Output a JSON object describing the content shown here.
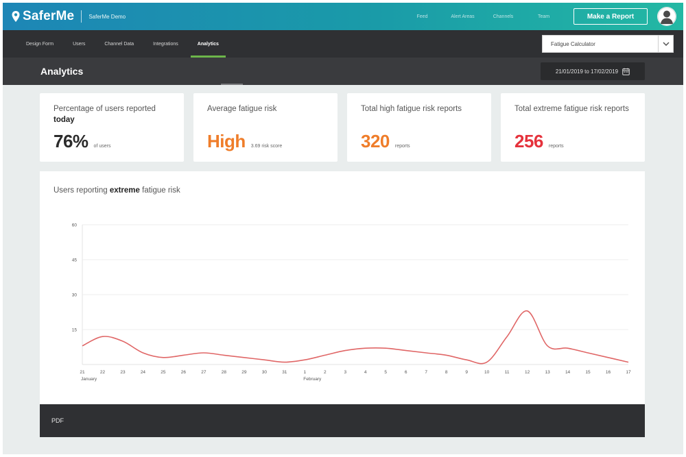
{
  "header": {
    "brand": "SaferMe",
    "org": "SaferMe Demo",
    "links": [
      "Feed",
      "Alert Areas",
      "Channels",
      "Team"
    ],
    "report_button": "Make a Report"
  },
  "subnav": {
    "tabs": [
      "Design Form",
      "Users",
      "Channel Data",
      "Integrations",
      "Analytics"
    ],
    "active_tab": "Analytics",
    "calculator_select": "Fatigue Calculator"
  },
  "titlebar": {
    "title": "Analytics",
    "date_range": "21/01/2019 to 17/02/2019"
  },
  "cards": [
    {
      "label_pre": "Percentage of users reported ",
      "label_bold": "today",
      "label_post": "",
      "value": "76%",
      "unit": "of users",
      "color": "#2b2b2b"
    },
    {
      "label_pre": "Average fatigue risk",
      "label_bold": "",
      "label_post": "",
      "value": "High",
      "unit": "3.69 risk score",
      "color": "#ef7d2a"
    },
    {
      "label_pre": "Total high fatigue risk reports",
      "label_bold": "",
      "label_post": "",
      "value": "320",
      "unit": "reports",
      "color": "#ef7d2a"
    },
    {
      "label_pre": "Total extreme fatigue risk reports",
      "label_bold": "",
      "label_post": "",
      "value": "256",
      "unit": "reports",
      "color": "#e5323c"
    }
  ],
  "chart": {
    "title_pre": "Users reporting ",
    "title_bold": "extreme",
    "title_post": " fatigue risk"
  },
  "chart_data": {
    "type": "line",
    "title": "Users reporting extreme fatigue risk",
    "x": [
      "21",
      "22",
      "23",
      "24",
      "25",
      "26",
      "27",
      "28",
      "29",
      "30",
      "31",
      "1",
      "2",
      "3",
      "4",
      "5",
      "6",
      "7",
      "8",
      "9",
      "10",
      "11",
      "12",
      "13",
      "14",
      "15",
      "16",
      "17"
    ],
    "month_labels": [
      {
        "index": 0,
        "label": "January"
      },
      {
        "index": 11,
        "label": "February"
      }
    ],
    "yticks": [
      15,
      30,
      45,
      60
    ],
    "ylim": [
      0,
      60
    ],
    "grid": true,
    "series": [
      {
        "values": [
          8,
          12,
          10,
          5,
          3,
          4,
          5,
          4,
          3,
          2,
          1,
          2,
          4,
          6,
          7,
          7,
          6,
          5,
          4,
          2,
          1,
          12,
          23,
          8,
          7,
          5,
          3,
          1
        ]
      }
    ],
    "line_color": "#e06666"
  },
  "footer": {
    "pdf_label": "PDF"
  }
}
